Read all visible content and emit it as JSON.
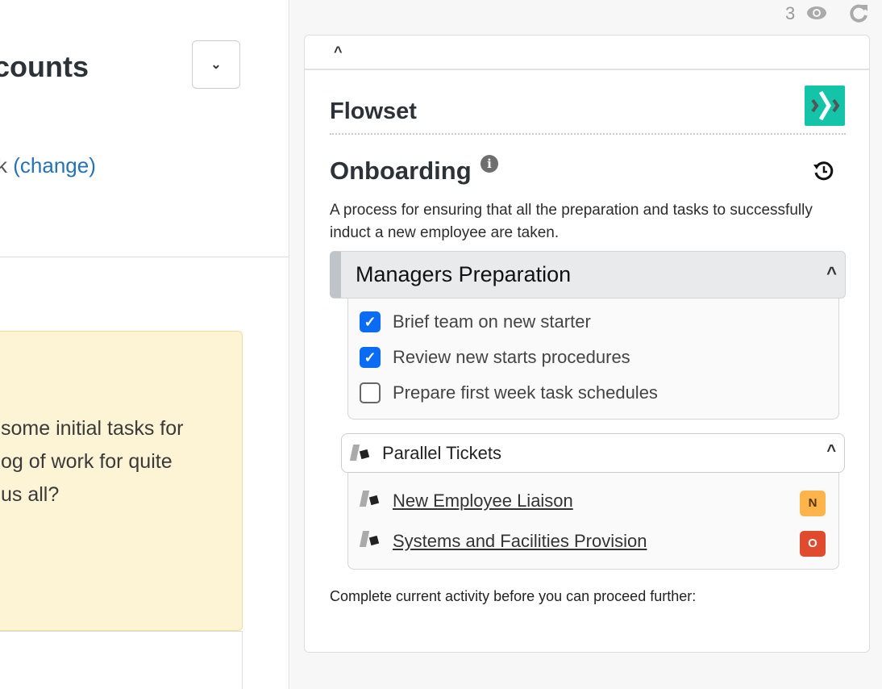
{
  "left": {
    "title": "counts",
    "dropdown_icon": "chevron-down-icon",
    "change_prefix": "k",
    "change_link": "(change)",
    "message_lines": [
      "some initial tasks for",
      "og of work for quite",
      "us all?"
    ]
  },
  "right": {
    "view_count": "3",
    "eye_icon": "eye-icon",
    "refresh_icon": "refresh-icon",
    "collapse_icon": "chevron-up-icon",
    "brand": "Flowset",
    "brand_color": "#14c4a8",
    "process_title": "Onboarding",
    "history_icon": "history-icon",
    "process_description": "A process for ensuring that all the preparation and tasks to successfully induct a new employee are taken.",
    "stage": {
      "title": "Managers Preparation",
      "checklist": [
        {
          "label": "Brief team on new starter",
          "checked": true
        },
        {
          "label": "Review new starts procedures",
          "checked": true
        },
        {
          "label": "Prepare first week task schedules",
          "checked": false
        }
      ]
    },
    "parallel": {
      "title": "Parallel Tickets",
      "tickets": [
        {
          "label": "New Employee Liaison",
          "badge": "N",
          "badge_color": "#fdb44b"
        },
        {
          "label": "Systems and Facilities Provision",
          "badge": "O",
          "badge_color": "#e04b2e"
        }
      ]
    },
    "footer": "Complete current activity before you can proceed further:"
  }
}
